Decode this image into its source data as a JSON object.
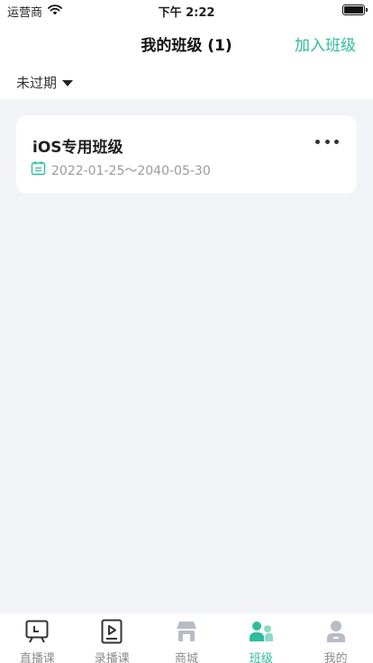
{
  "status_bar": {
    "carrier": "运营商",
    "time": "下午 2:22",
    "battery_level": 1.0
  },
  "nav": {
    "title": "我的班级 (1)",
    "action_label": "加入班级"
  },
  "filter": {
    "selected": "未过期"
  },
  "classes": [
    {
      "name": "iOS专用班级",
      "date_range": "2022-01-25～2040-05-30"
    }
  ],
  "tabs": [
    {
      "label": "直播课",
      "icon": "live-course-icon",
      "active": false
    },
    {
      "label": "录播课",
      "icon": "recorded-course-icon",
      "active": false
    },
    {
      "label": "商城",
      "icon": "store-icon",
      "active": false
    },
    {
      "label": "班级",
      "icon": "class-icon",
      "active": true
    },
    {
      "label": "我的",
      "icon": "profile-icon",
      "active": false
    }
  ],
  "colors": {
    "accent": "#2ebd9c",
    "background": "#f1f3f7",
    "inactive_icon": "#b7bcc7"
  }
}
